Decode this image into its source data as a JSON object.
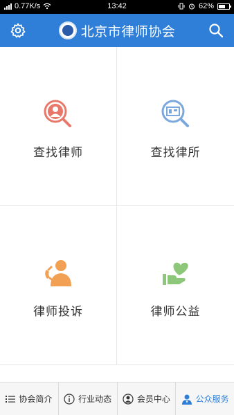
{
  "status_bar": {
    "network_speed": "0.77K/s",
    "time": "13:42",
    "battery": "62%"
  },
  "header": {
    "title": "北京市律师协会"
  },
  "tiles": [
    {
      "label": "查找律师",
      "icon": "find-lawyer-icon",
      "color": "#e8796a"
    },
    {
      "label": "查找律所",
      "icon": "find-firm-icon",
      "color": "#7aa7dc"
    },
    {
      "label": "律师投诉",
      "icon": "complaint-icon",
      "color": "#f2a154"
    },
    {
      "label": "律师公益",
      "icon": "charity-icon",
      "color": "#8cc77a"
    }
  ],
  "tabbar": {
    "items": [
      {
        "label": "协会简介",
        "icon": "list-icon"
      },
      {
        "label": "行业动态",
        "icon": "info-icon"
      },
      {
        "label": "会员中心",
        "icon": "member-icon"
      },
      {
        "label": "公众服务",
        "icon": "public-service-icon",
        "active": true
      }
    ]
  },
  "colors": {
    "primary": "#2f7fd8"
  }
}
